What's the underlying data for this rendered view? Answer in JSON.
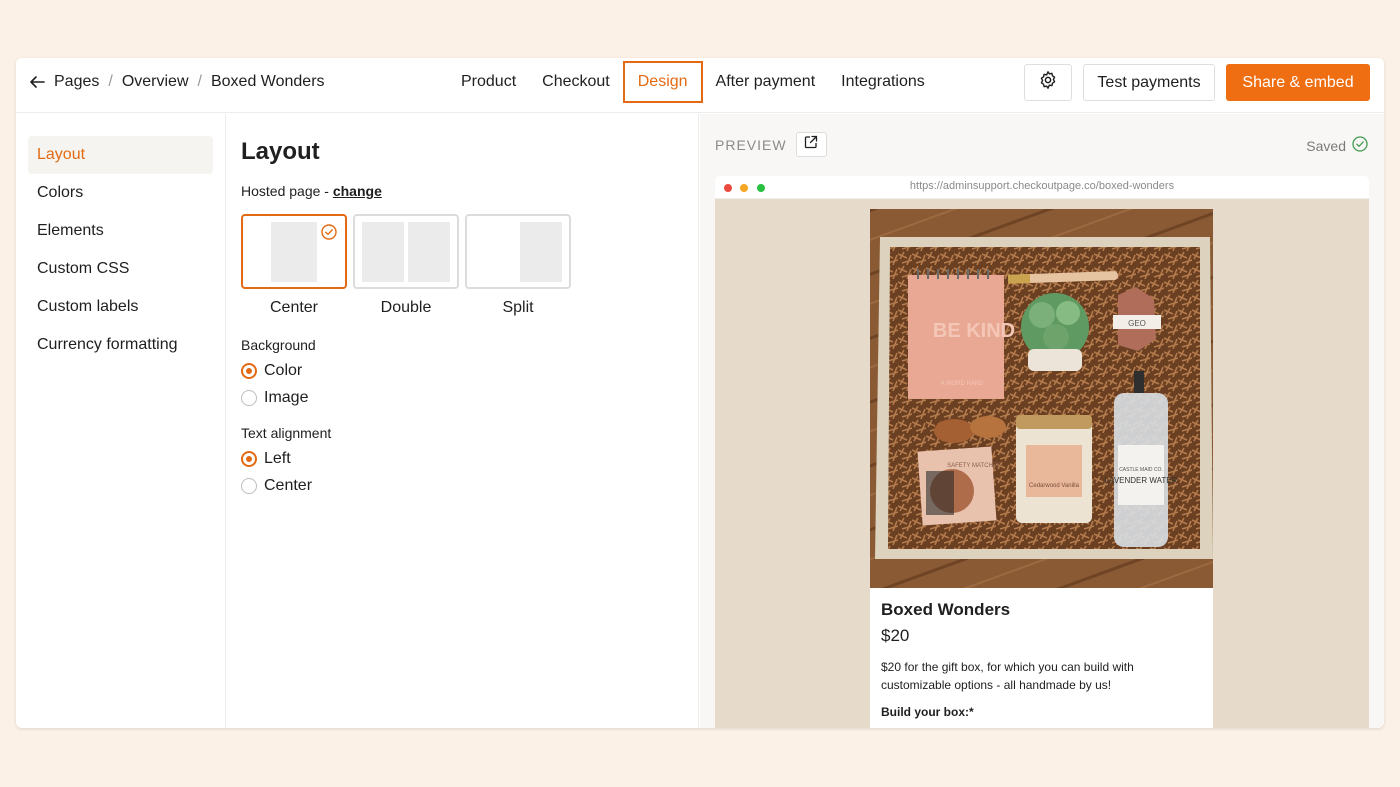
{
  "breadcrumb": {
    "items": [
      "Pages",
      "Overview",
      "Boxed Wonders"
    ]
  },
  "tabs": [
    {
      "label": "Product",
      "active": false
    },
    {
      "label": "Checkout",
      "active": false
    },
    {
      "label": "Design",
      "active": true
    },
    {
      "label": "After payment",
      "active": false
    },
    {
      "label": "Integrations",
      "active": false
    }
  ],
  "toolbar": {
    "settings_icon": "gear-icon",
    "test_label": "Test payments",
    "share_label": "Share & embed"
  },
  "sidebar": {
    "items": [
      {
        "label": "Layout",
        "active": true
      },
      {
        "label": "Colors",
        "active": false
      },
      {
        "label": "Elements",
        "active": false
      },
      {
        "label": "Custom CSS",
        "active": false
      },
      {
        "label": "Custom labels",
        "active": false
      },
      {
        "label": "Currency formatting",
        "active": false
      }
    ]
  },
  "settings": {
    "title": "Layout",
    "hosted_prefix": "Hosted page - ",
    "hosted_link": "change",
    "layouts": [
      {
        "label": "Center",
        "selected": true
      },
      {
        "label": "Double",
        "selected": false
      },
      {
        "label": "Split",
        "selected": false
      }
    ],
    "background": {
      "label": "Background",
      "options": [
        {
          "label": "Color",
          "checked": true
        },
        {
          "label": "Image",
          "checked": false
        }
      ]
    },
    "alignment": {
      "label": "Text alignment",
      "options": [
        {
          "label": "Left",
          "checked": true
        },
        {
          "label": "Center",
          "checked": false
        }
      ]
    }
  },
  "preview": {
    "label": "PREVIEW",
    "saved": "Saved",
    "url": "https://adminsupport.checkoutpage.co/boxed-wonders",
    "product": {
      "title": "Boxed Wonders",
      "price": "$20",
      "description": "$20 for the gift box, for which you can build with customizable options - all handmade by us!",
      "build_label": "Build your box:*"
    },
    "photo_labels": {
      "notebook": "BE KIND",
      "notebook_small": "A WORD HARD",
      "candle": "Cedarwood Vanilla",
      "spray": "LAVENDER WATER",
      "spray_small": "CASTLE MAID CO.",
      "soap": "GEO",
      "matches": "SAFETY MATCHES"
    }
  },
  "colors": {
    "accent": "#f06e12",
    "accent_border": "#e36a13",
    "page_bg": "#fcf1e6",
    "preview_canvas": "#e6dacb"
  }
}
